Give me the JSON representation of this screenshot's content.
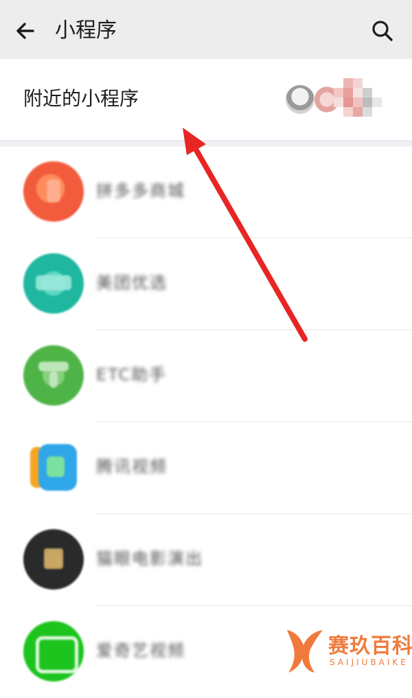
{
  "header": {
    "title": "小程序",
    "back_icon": "arrow-left-icon",
    "search_icon": "search-icon"
  },
  "nearby": {
    "label": "附近的小程序"
  },
  "apps": [
    {
      "name": "拼多多商城",
      "icon": "app-icon-red",
      "color": "#f25b3b"
    },
    {
      "name": "美团优选",
      "icon": "app-icon-teal",
      "color": "#1fb7a0"
    },
    {
      "name": "ETC助手",
      "icon": "app-icon-green",
      "color": "#4fb448"
    },
    {
      "name": "腾讯视频",
      "icon": "app-icon-play",
      "color": "#2fa7e8"
    },
    {
      "name": "猫眼电影演出",
      "icon": "app-icon-dark",
      "color": "#2a2a2a"
    },
    {
      "name": "爱奇艺视频",
      "icon": "app-icon-iqiyi",
      "color": "#1ec41e"
    }
  ],
  "annotation": {
    "arrow_color": "#e82525"
  },
  "watermark": {
    "text": "赛玖百科",
    "sub": "SAIJIUBAIKE",
    "color": "#f07a3c"
  }
}
